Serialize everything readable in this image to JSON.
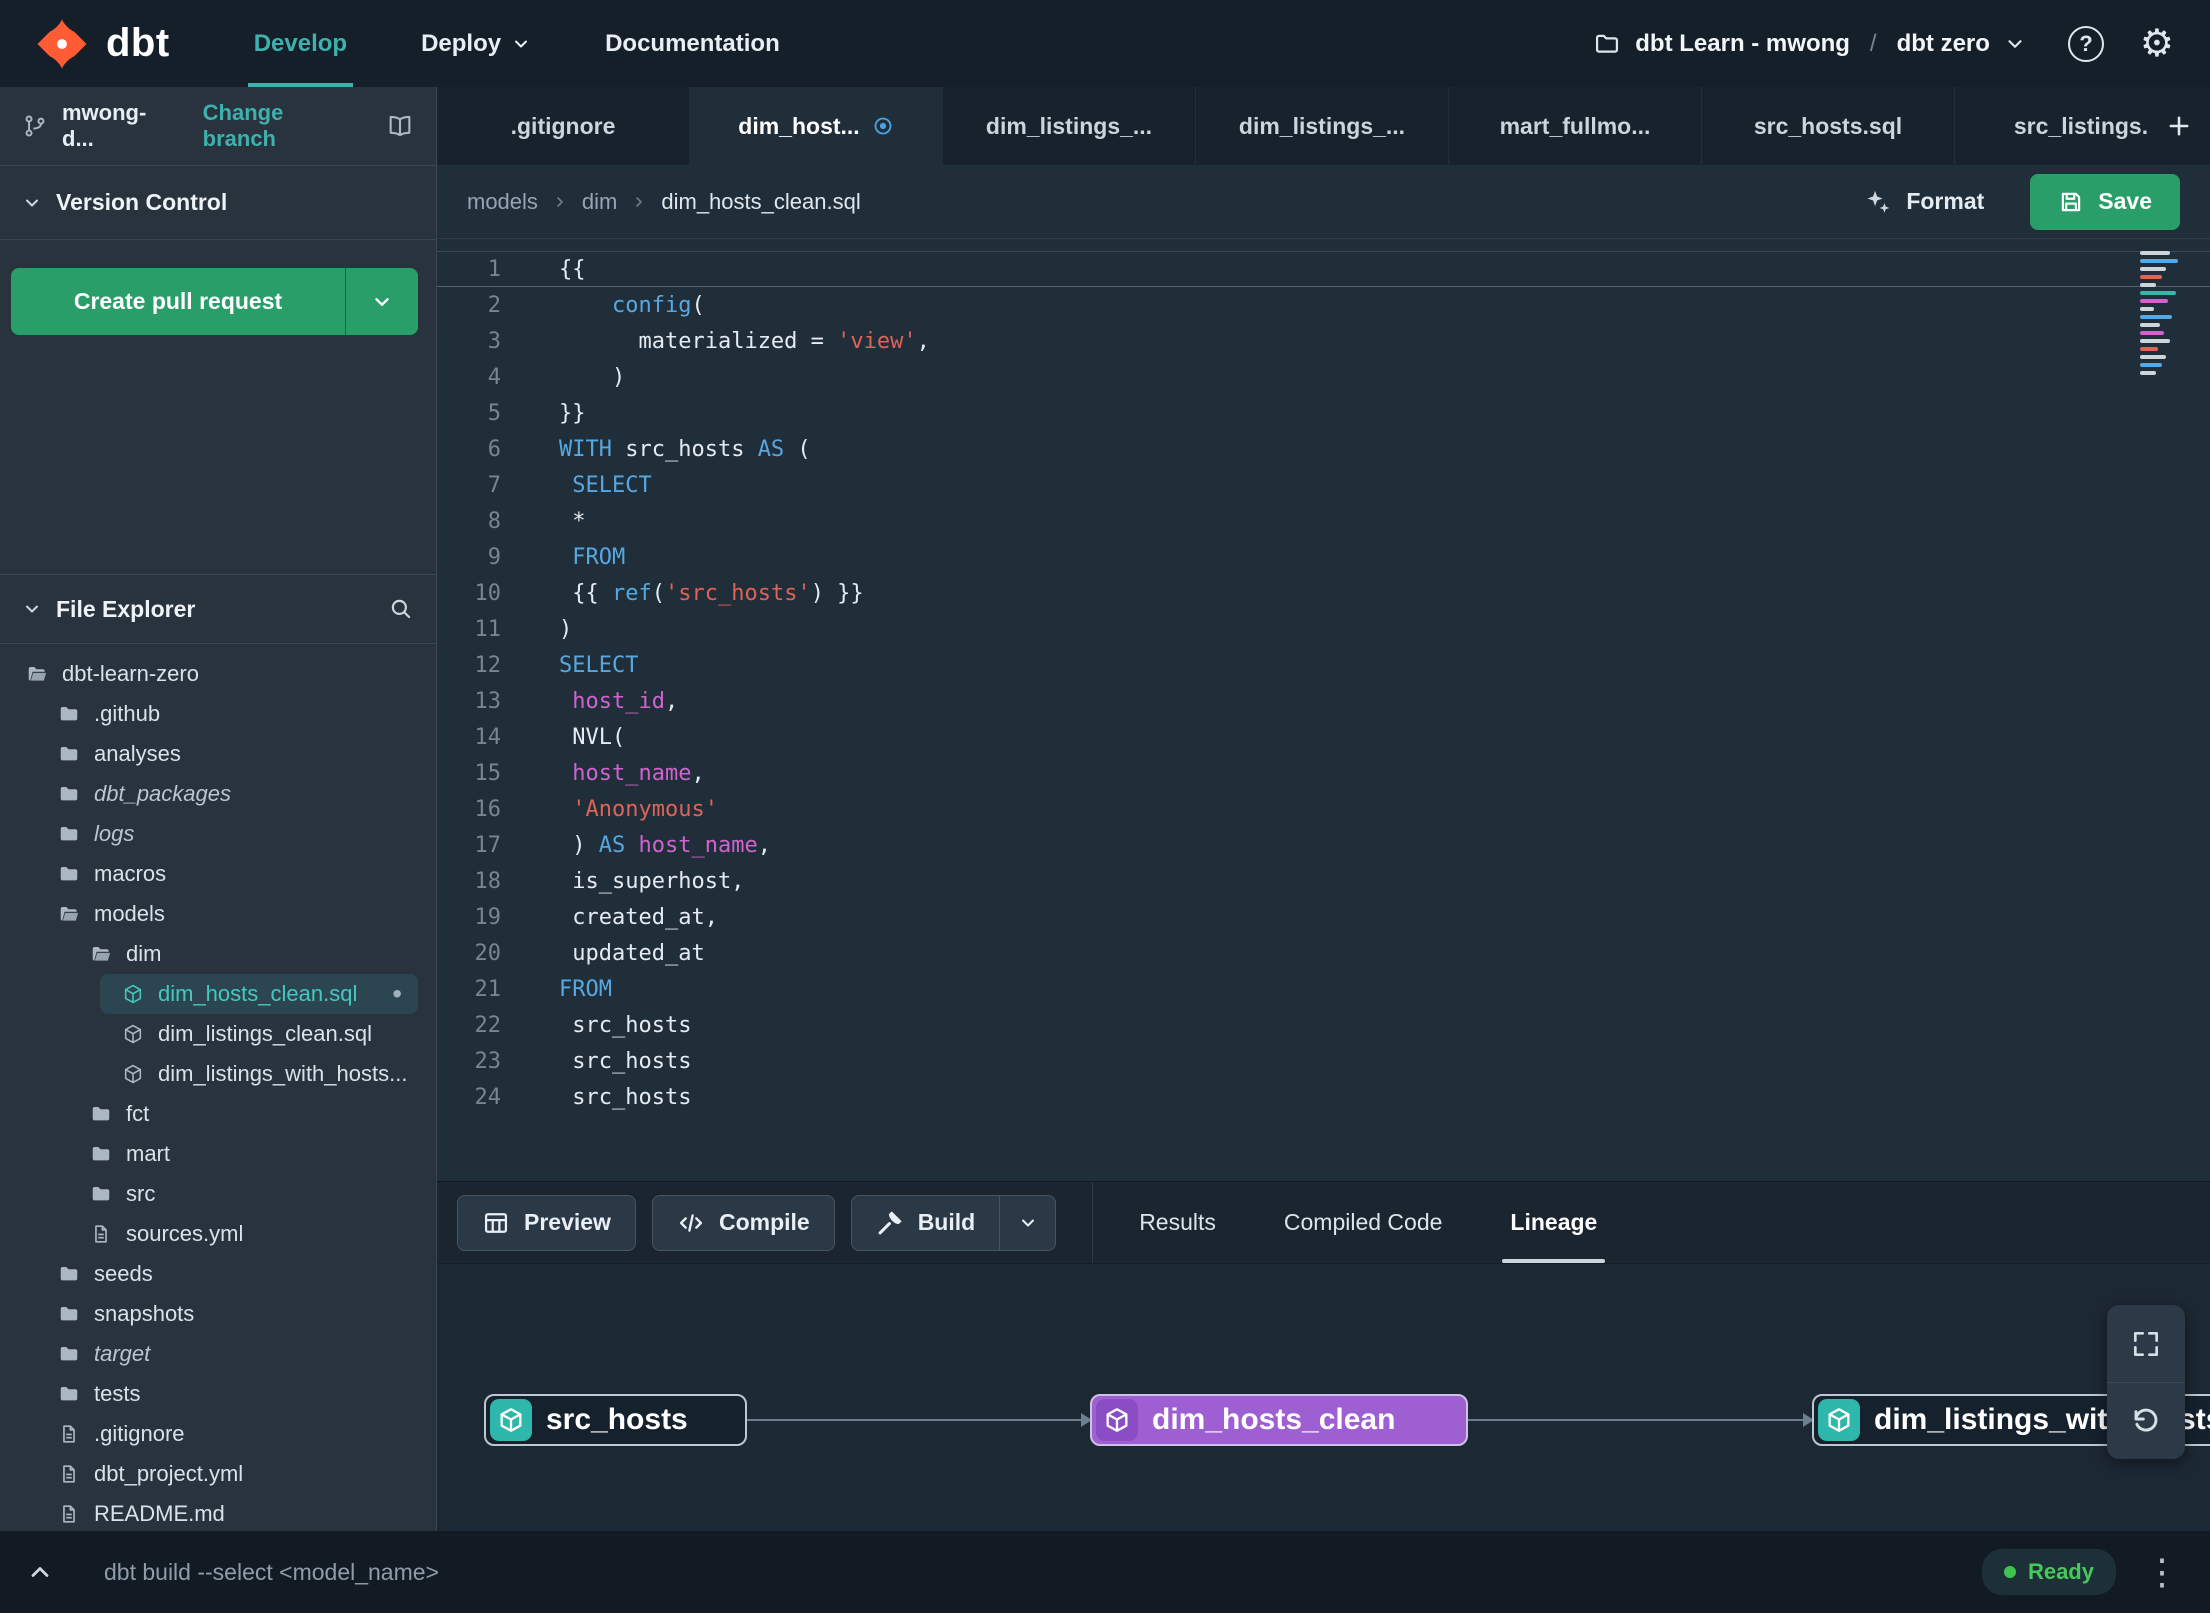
{
  "icons": {
    "gear-icon": "⚙",
    "help-icon": "?",
    "overflow-menu-icon": "⋮",
    "unsaved-dot": "•"
  },
  "colors": {
    "accent_teal": "#3fb1ac",
    "brand_orange": "#ff5c35",
    "action_green": "#299e68",
    "lineage_purple": "#9d5fd2",
    "status_ready_green": "#3fc34f",
    "code_keyword": "#57a8e0",
    "code_string": "#de6358",
    "code_field": "#d063d0"
  },
  "navbar": {
    "brand": "dbt",
    "items": [
      {
        "label": "Develop",
        "active": true
      },
      {
        "label": "Deploy",
        "chevron": true
      },
      {
        "label": "Documentation"
      }
    ],
    "project": {
      "name": "dbt Learn - mwong",
      "separator": "/",
      "env": "dbt zero"
    }
  },
  "sidebar": {
    "branch": {
      "name": "mwong-d...",
      "action": "Change branch"
    },
    "version_control": {
      "title": "Version Control",
      "create_pr_label": "Create pull request"
    },
    "file_explorer": {
      "title": "File Explorer"
    },
    "tree": [
      {
        "label": "dbt-learn-zero",
        "icon": "folder-open-icon",
        "depth": 0
      },
      {
        "label": ".github",
        "icon": "folder-icon",
        "depth": 1
      },
      {
        "label": "analyses",
        "icon": "folder-icon",
        "depth": 1
      },
      {
        "label": "dbt_packages",
        "icon": "folder-icon",
        "depth": 1,
        "italic": true
      },
      {
        "label": "logs",
        "icon": "folder-icon",
        "depth": 1,
        "italic": true
      },
      {
        "label": "macros",
        "icon": "folder-icon",
        "depth": 1
      },
      {
        "label": "models",
        "icon": "folder-open-icon",
        "depth": 1
      },
      {
        "label": "dim",
        "icon": "folder-open-icon",
        "depth": 2
      },
      {
        "label": "dim_hosts_clean.sql",
        "icon": "model-icon",
        "depth": 3,
        "selected": true,
        "modified": true
      },
      {
        "label": "dim_listings_clean.sql",
        "icon": "model-icon",
        "depth": 3
      },
      {
        "label": "dim_listings_with_hosts...",
        "icon": "model-icon",
        "depth": 3
      },
      {
        "label": "fct",
        "icon": "folder-icon",
        "depth": 2
      },
      {
        "label": "mart",
        "icon": "folder-icon",
        "depth": 2
      },
      {
        "label": "src",
        "icon": "folder-icon",
        "depth": 2
      },
      {
        "label": "sources.yml",
        "icon": "file-icon",
        "depth": 2
      },
      {
        "label": "seeds",
        "icon": "folder-icon",
        "depth": 1
      },
      {
        "label": "snapshots",
        "icon": "folder-icon",
        "depth": 1
      },
      {
        "label": "target",
        "icon": "folder-icon",
        "depth": 1,
        "italic": true
      },
      {
        "label": "tests",
        "icon": "folder-icon",
        "depth": 1
      },
      {
        "label": ".gitignore",
        "icon": "file-icon",
        "depth": 1
      },
      {
        "label": "dbt_project.yml",
        "icon": "file-icon",
        "depth": 1
      },
      {
        "label": "README.md",
        "icon": "file-icon",
        "depth": 1
      }
    ]
  },
  "tabs": [
    {
      "label": ".gitignore"
    },
    {
      "label": "dim_host...",
      "active": true,
      "modified": true
    },
    {
      "label": "dim_listings_..."
    },
    {
      "label": "dim_listings_..."
    },
    {
      "label": "mart_fullmo..."
    },
    {
      "label": "src_hosts.sql"
    },
    {
      "label": "src_listings."
    }
  ],
  "breadcrumb": [
    "models",
    "dim",
    "dim_hosts_clean.sql"
  ],
  "editor_actions": {
    "format_label": "Format",
    "save_label": "Save"
  },
  "editor": {
    "lines": [
      {
        "n": 1,
        "current": true,
        "segs": [
          [
            "{{",
            "p"
          ]
        ]
      },
      {
        "n": 2,
        "segs": [
          [
            "    ",
            "p"
          ],
          [
            "config",
            "fn"
          ],
          [
            "(",
            "p"
          ]
        ]
      },
      {
        "n": 3,
        "segs": [
          [
            "      ",
            "p"
          ],
          [
            "materialized = ",
            "p"
          ],
          [
            "'view'",
            "str"
          ],
          [
            ",",
            "p"
          ]
        ]
      },
      {
        "n": 4,
        "segs": [
          [
            "    )",
            "p"
          ]
        ]
      },
      {
        "n": 5,
        "segs": [
          [
            "}}",
            "p"
          ]
        ]
      },
      {
        "n": 6,
        "segs": [
          [
            "WITH",
            "kw"
          ],
          [
            " src_hosts ",
            "p"
          ],
          [
            "AS",
            "kw"
          ],
          [
            " (",
            "p"
          ]
        ]
      },
      {
        "n": 7,
        "segs": [
          [
            " ",
            "p"
          ],
          [
            "SELECT",
            "kw"
          ]
        ]
      },
      {
        "n": 8,
        "segs": [
          [
            " *",
            "p"
          ]
        ]
      },
      {
        "n": 9,
        "segs": [
          [
            " ",
            "p"
          ],
          [
            "FROM",
            "kw"
          ]
        ]
      },
      {
        "n": 10,
        "segs": [
          [
            " {{ ",
            "p"
          ],
          [
            "ref",
            "fn"
          ],
          [
            "(",
            "p"
          ],
          [
            "'src_hosts'",
            "str"
          ],
          [
            ") }}",
            "p"
          ]
        ]
      },
      {
        "n": 11,
        "segs": [
          [
            ")",
            "p"
          ]
        ]
      },
      {
        "n": 12,
        "segs": [
          [
            "SELECT",
            "kw"
          ]
        ]
      },
      {
        "n": 13,
        "segs": [
          [
            " ",
            "p"
          ],
          [
            "host_id",
            "var"
          ],
          [
            ",",
            "p"
          ]
        ]
      },
      {
        "n": 14,
        "segs": [
          [
            " NVL(",
            "p"
          ]
        ]
      },
      {
        "n": 15,
        "segs": [
          [
            " ",
            "p"
          ],
          [
            "host_name",
            "var"
          ],
          [
            ",",
            "p"
          ]
        ]
      },
      {
        "n": 16,
        "segs": [
          [
            " ",
            "p"
          ],
          [
            "'Anonymous'",
            "str"
          ]
        ]
      },
      {
        "n": 17,
        "segs": [
          [
            " ) ",
            "p"
          ],
          [
            "AS",
            "kw"
          ],
          [
            " ",
            "p"
          ],
          [
            "host_name",
            "var"
          ],
          [
            ",",
            "p"
          ]
        ]
      },
      {
        "n": 18,
        "segs": [
          [
            " is_superhost,",
            "p"
          ]
        ]
      },
      {
        "n": 19,
        "segs": [
          [
            " created_at,",
            "p"
          ]
        ]
      },
      {
        "n": 20,
        "segs": [
          [
            " updated_at",
            "p"
          ]
        ]
      },
      {
        "n": 21,
        "segs": [
          [
            "FROM",
            "kw"
          ]
        ]
      },
      {
        "n": 22,
        "segs": [
          [
            " src_hosts",
            "p"
          ]
        ]
      },
      {
        "n": 23,
        "segs": [
          [
            " src_hosts",
            "p"
          ]
        ]
      },
      {
        "n": 24,
        "segs": [
          [
            " src_hosts",
            "p"
          ]
        ]
      }
    ]
  },
  "bottom_panel": {
    "action_buttons": [
      {
        "label": "Preview",
        "icon": "table-icon"
      },
      {
        "label": "Compile",
        "icon": "code-icon"
      },
      {
        "label": "Build",
        "icon": "hammer-icon",
        "split": true
      }
    ],
    "tabs": [
      {
        "label": "Results"
      },
      {
        "label": "Compiled Code"
      },
      {
        "label": "Lineage",
        "active": true
      }
    ]
  },
  "lineage": {
    "nodes": [
      {
        "label": "src_hosts",
        "variant": "teal"
      },
      {
        "label": "dim_hosts_clean",
        "variant": "purple"
      },
      {
        "label": "dim_listings_with_hosts",
        "variant": "teal"
      }
    ]
  },
  "command_bar": {
    "command": "dbt build --select <model_name>",
    "status_label": "Ready"
  }
}
